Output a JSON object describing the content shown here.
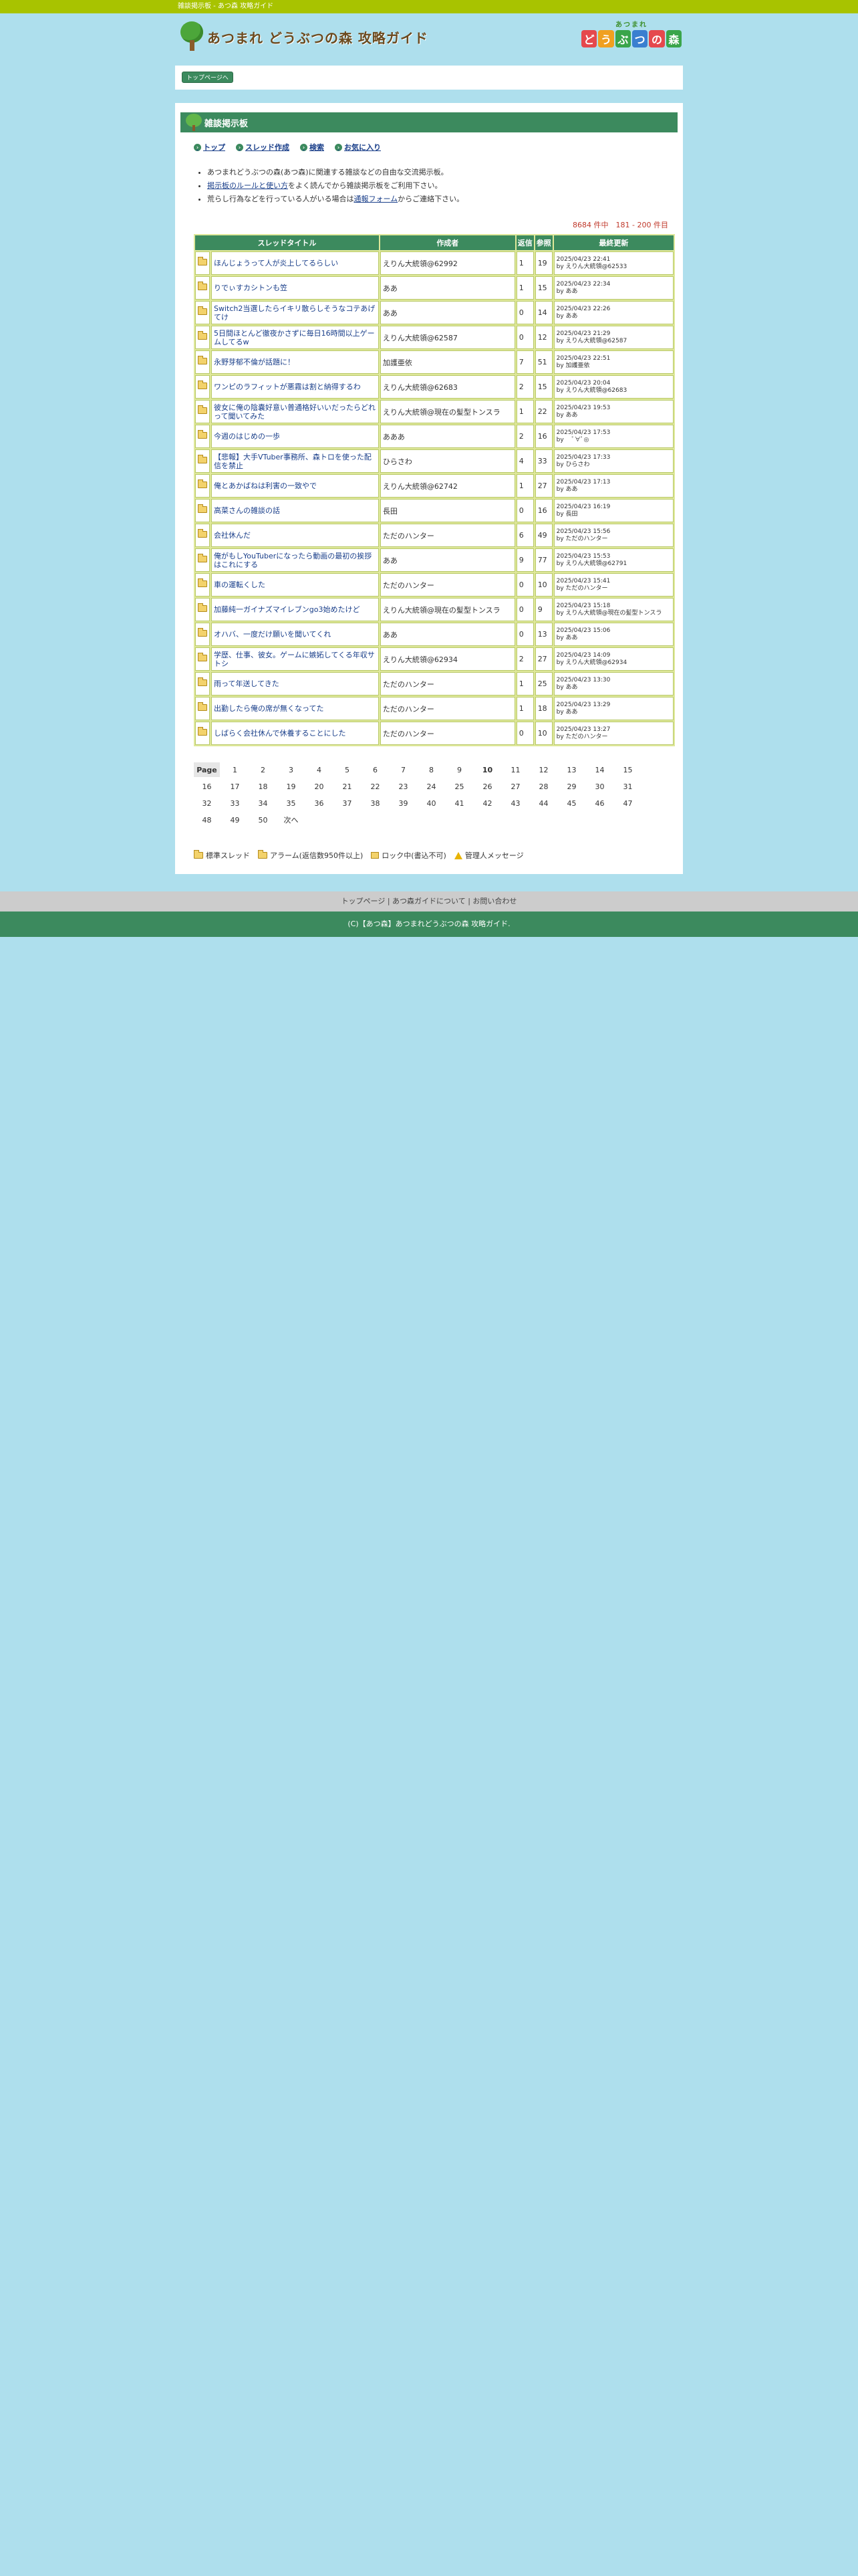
{
  "topbar": "雑談掲示板 - あつ森 攻略ガイド",
  "site_title": "あつまれ どうぶつの森 攻略ガイド",
  "logo_right": {
    "top": "あつまれ",
    "chars": [
      "ど",
      "う",
      "ぶ",
      "つ",
      "の",
      "森"
    ],
    "colors": [
      "#e5484d",
      "#f0a020",
      "#3aa54a",
      "#3a7fd0",
      "#e5484d",
      "#3aa54a"
    ]
  },
  "nav": {
    "top_label": "トップページへ"
  },
  "board": {
    "title": "雑談掲示板",
    "links": [
      "トップ",
      "スレッド作成",
      "検索",
      "お気に入り"
    ],
    "notes": [
      {
        "pre": "",
        "text": "あつまれどうぶつの森(あつ森)に関連する雑談などの自由な交流掲示板。",
        "link": "",
        "post": ""
      },
      {
        "pre": "",
        "text": "",
        "link": "掲示板のルールと使い方",
        "post": "をよく読んでから雑談掲示板をご利用下さい。"
      },
      {
        "pre": "荒らし行為などを行っている人がいる場合は",
        "text": "",
        "link": "通報フォーム",
        "post": "からご連絡下さい。"
      }
    ],
    "count": "8684 件中　181 - 200 件目",
    "headers": [
      "スレッドタイトル",
      "作成者",
      "返信",
      "参照",
      "最終更新"
    ],
    "threads": [
      {
        "title": "ほんじょうって人が炎上してるらしい",
        "author": "えりん大統領@62992",
        "replies": "1",
        "views": "19",
        "updated": "2025/04/23 22:41",
        "by": "by えりん大統領@62533"
      },
      {
        "title": "りでぃすカシトンも笠",
        "author": "ああ",
        "replies": "1",
        "views": "15",
        "updated": "2025/04/23 22:34",
        "by": "by ああ"
      },
      {
        "title": "Switch2当選したらイキリ散らしそうなコテあげてけ",
        "author": "ああ",
        "replies": "0",
        "views": "14",
        "updated": "2025/04/23 22:26",
        "by": "by ああ"
      },
      {
        "title": "5日間ほとんど徹夜かさずに毎日16時間以上ゲームしてるw",
        "author": "えりん大統領@62587",
        "replies": "0",
        "views": "12",
        "updated": "2025/04/23 21:29",
        "by": "by えりん大統領@62587"
      },
      {
        "title": "永野芽郁不倫が話題に！",
        "author": "加護亜依",
        "replies": "7",
        "views": "51",
        "updated": "2025/04/23 22:51",
        "by": "by 加護亜依"
      },
      {
        "title": "ワンピのラフィットが悪霧は割と納得するわ",
        "author": "えりん大統領@62683",
        "replies": "2",
        "views": "15",
        "updated": "2025/04/23 20:04",
        "by": "by えりん大統領@62683"
      },
      {
        "title": "彼女に俺の陰嚢好意い普通格好いいだったらどれって聞いてみた",
        "author": "えりん大統領@現在の髪型トンスラ",
        "replies": "1",
        "views": "22",
        "updated": "2025/04/23 19:53",
        "by": "by ああ"
      },
      {
        "title": "今週のはじめの一歩",
        "author": "あああ",
        "replies": "2",
        "views": "16",
        "updated": "2025/04/23 17:53",
        "by": "by 　ﾟ∀ﾟ◎"
      },
      {
        "title": "【悲報】大手VTuber事務所、森トロを使った配信を禁止",
        "author": "ひらさわ",
        "replies": "4",
        "views": "33",
        "updated": "2025/04/23 17:33",
        "by": "by ひらさわ"
      },
      {
        "title": "俺とあかばねは利害の一致やで",
        "author": "えりん大統領@62742",
        "replies": "1",
        "views": "27",
        "updated": "2025/04/23 17:13",
        "by": "by ああ"
      },
      {
        "title": "高菜さんの雑談の話",
        "author": "長田",
        "replies": "0",
        "views": "16",
        "updated": "2025/04/23 16:19",
        "by": "by 長田"
      },
      {
        "title": "会社休んだ",
        "author": "ただのハンター",
        "replies": "6",
        "views": "49",
        "updated": "2025/04/23 15:56",
        "by": "by ただのハンター"
      },
      {
        "title": "俺がもしYouTuberになったら動画の最初の挨拶はこれにする",
        "author": "ああ",
        "replies": "9",
        "views": "77",
        "updated": "2025/04/23 15:53",
        "by": "by えりん大統領@62791"
      },
      {
        "title": "車の運転くした",
        "author": "ただのハンター",
        "replies": "0",
        "views": "10",
        "updated": "2025/04/23 15:41",
        "by": "by ただのハンター"
      },
      {
        "title": "加藤純一ガイナズマイレブンgo3始めたけど",
        "author": "えりん大統領@現在の髪型トンスラ",
        "replies": "0",
        "views": "9",
        "updated": "2025/04/23 15:18",
        "by": "by えりん大統領@現在の髪型トンスラ"
      },
      {
        "title": "オハバ、一度だけ願いを聞いてくれ",
        "author": "ああ",
        "replies": "0",
        "views": "13",
        "updated": "2025/04/23 15:06",
        "by": "by ああ"
      },
      {
        "title": "学歴、仕事、彼女。ゲームに嫉妬してくる年収サトシ",
        "author": "えりん大統領@62934",
        "replies": "2",
        "views": "27",
        "updated": "2025/04/23 14:09",
        "by": "by えりん大統領@62934"
      },
      {
        "title": "雨って年送してきた",
        "author": "ただのハンター",
        "replies": "1",
        "views": "25",
        "updated": "2025/04/23 13:30",
        "by": "by ああ"
      },
      {
        "title": "出勤したら俺の席が無くなってた",
        "author": "ただのハンター",
        "replies": "1",
        "views": "18",
        "updated": "2025/04/23 13:29",
        "by": "by ああ"
      },
      {
        "title": "しばらく会社休んで休養することにした",
        "author": "ただのハンター",
        "replies": "0",
        "views": "10",
        "updated": "2025/04/23 13:27",
        "by": "by ただのハンター"
      }
    ]
  },
  "pager": {
    "label": "Page",
    "current": "10",
    "pages": [
      "1",
      "2",
      "3",
      "4",
      "5",
      "6",
      "7",
      "8",
      "9",
      "10",
      "11",
      "12",
      "13",
      "14",
      "15",
      "16",
      "17",
      "18",
      "19",
      "20",
      "21",
      "22",
      "23",
      "24",
      "25",
      "26",
      "27",
      "28",
      "29",
      "30",
      "31",
      "32",
      "33",
      "34",
      "35",
      "36",
      "37",
      "38",
      "39",
      "40",
      "41",
      "42",
      "43",
      "44",
      "45",
      "46",
      "47",
      "48",
      "49",
      "50",
      "次へ"
    ]
  },
  "legend": [
    "標準スレッド",
    "アラーム(返信数950件以上)",
    "ロック中(書込不可)",
    "管理人メッセージ"
  ],
  "footer": {
    "nav": "トップページ | あつ森ガイドについて | お問い合わせ",
    "copyright": "(C)【あつ森】あつまれどうぶつの森 攻略ガイド."
  }
}
